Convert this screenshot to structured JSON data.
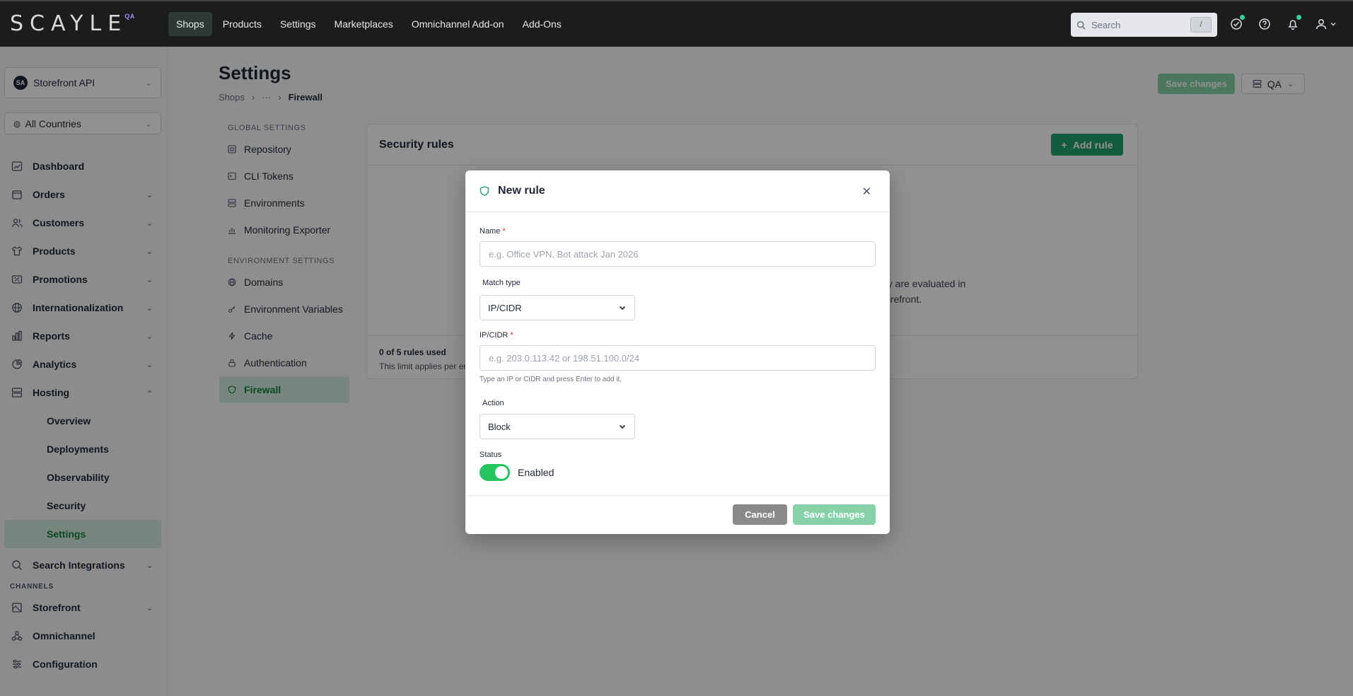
{
  "topbar": {
    "logo": "SCAYLE",
    "env_badge": "QA",
    "nav": [
      "Shops",
      "Products",
      "Settings",
      "Marketplaces",
      "Omnichannel Add-on",
      "Add-Ons"
    ],
    "active_nav": "Shops",
    "search_placeholder": "Search",
    "search_shortcut": "/"
  },
  "sidebar": {
    "shop_initials": "SA",
    "shop_name": "Storefront API",
    "country": "All Countries",
    "items": [
      {
        "label": "Dashboard",
        "icon": "dashboard-icon"
      },
      {
        "label": "Orders",
        "icon": "orders-icon"
      },
      {
        "label": "Customers",
        "icon": "customers-icon"
      },
      {
        "label": "Products",
        "icon": "products-icon"
      },
      {
        "label": "Promotions",
        "icon": "promotions-icon"
      },
      {
        "label": "Internationalization",
        "icon": "globe-icon"
      },
      {
        "label": "Reports",
        "icon": "reports-icon"
      },
      {
        "label": "Analytics",
        "icon": "analytics-icon"
      },
      {
        "label": "Hosting",
        "icon": "hosting-icon"
      }
    ],
    "hosting_sub": [
      "Overview",
      "Deployments",
      "Observability",
      "Security",
      "Settings"
    ],
    "search_integrations": "Search Integrations",
    "channels_label": "CHANNELS",
    "channels": [
      "Storefront",
      "Omnichannel",
      "Configuration"
    ]
  },
  "main": {
    "title": "Settings",
    "breadcrumb": [
      "Shops",
      "···",
      "Firewall"
    ],
    "save_button": "Save changes",
    "env_button": "QA",
    "global_settings_label": "GLOBAL SETTINGS",
    "global_settings": [
      "Repository",
      "CLI Tokens",
      "Environments",
      "Monitoring Exporter"
    ],
    "environment_settings_label": "ENVIRONMENT SETTINGS",
    "environment_settings": [
      "Domains",
      "Environment Variables",
      "Cache",
      "Authentication",
      "Firewall"
    ],
    "card": {
      "title": "Security rules",
      "add_button": "Add rule",
      "empty_line1": "ey are evaluated in",
      "empty_line2": "orefront.",
      "used": "0 of 5 rules used",
      "limit": "This limit applies per en"
    }
  },
  "modal": {
    "title": "New rule",
    "name_label": "Name",
    "name_placeholder": "e.g. Office VPN, Bot attack Jan 2026",
    "match_type_label": "Match type",
    "match_type_value": "IP/CIDR",
    "ipcidr_label": "IP/CIDR",
    "ipcidr_placeholder": "e.g. 203.0.113.42 or 198.51.100.0/24",
    "ipcidr_hint": "Type an IP or CIDR and press Enter to add it.",
    "action_label": "Action",
    "action_value": "Block",
    "status_label": "Status",
    "status_value": "Enabled",
    "status_enabled": true,
    "cancel_button": "Cancel",
    "save_button": "Save changes"
  },
  "colors": {
    "accent": "#22a06b",
    "accent_disabled": "#86d1a8",
    "toggle_on": "#22c55e",
    "topbar": "#1c1c1c"
  }
}
